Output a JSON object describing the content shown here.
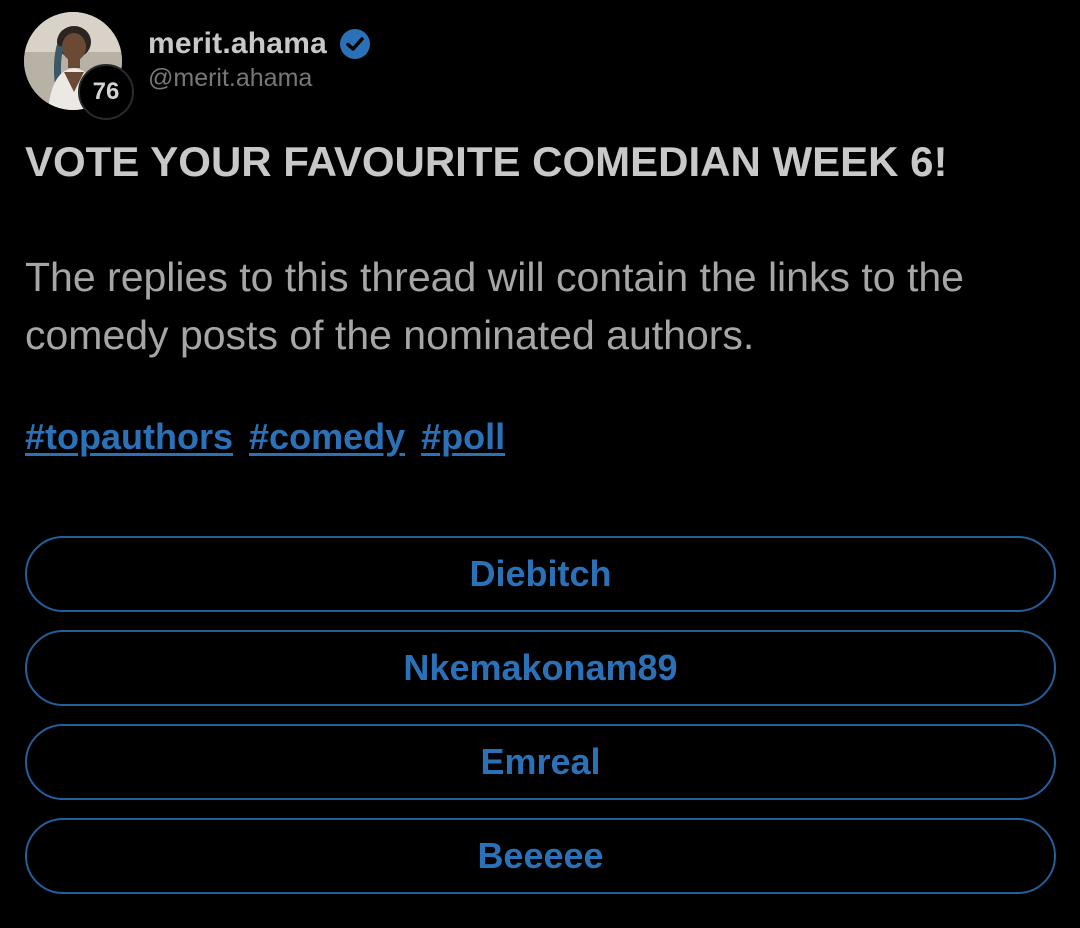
{
  "author": {
    "display_name": "merit.ahama",
    "handle": "@merit.ahama",
    "level": "76",
    "verified": true,
    "verified_icon": "verified-check-icon",
    "avatar_icon": "avatar-photo"
  },
  "post": {
    "title": "VOTE YOUR FAVOURITE COMEDIAN WEEK 6!",
    "body": "The replies to this thread will contain the links to the comedy posts of the nominated authors.",
    "hashtags": [
      "#topauthors",
      "#comedy",
      "#poll"
    ]
  },
  "poll": {
    "options": [
      "Diebitch",
      "Nkemakonam89",
      "Emreal",
      "Beeeee"
    ]
  },
  "colors": {
    "background": "#000000",
    "accent": "#2a71b8",
    "title_text": "#c8c8c8",
    "body_text": "#a6a6a6"
  }
}
